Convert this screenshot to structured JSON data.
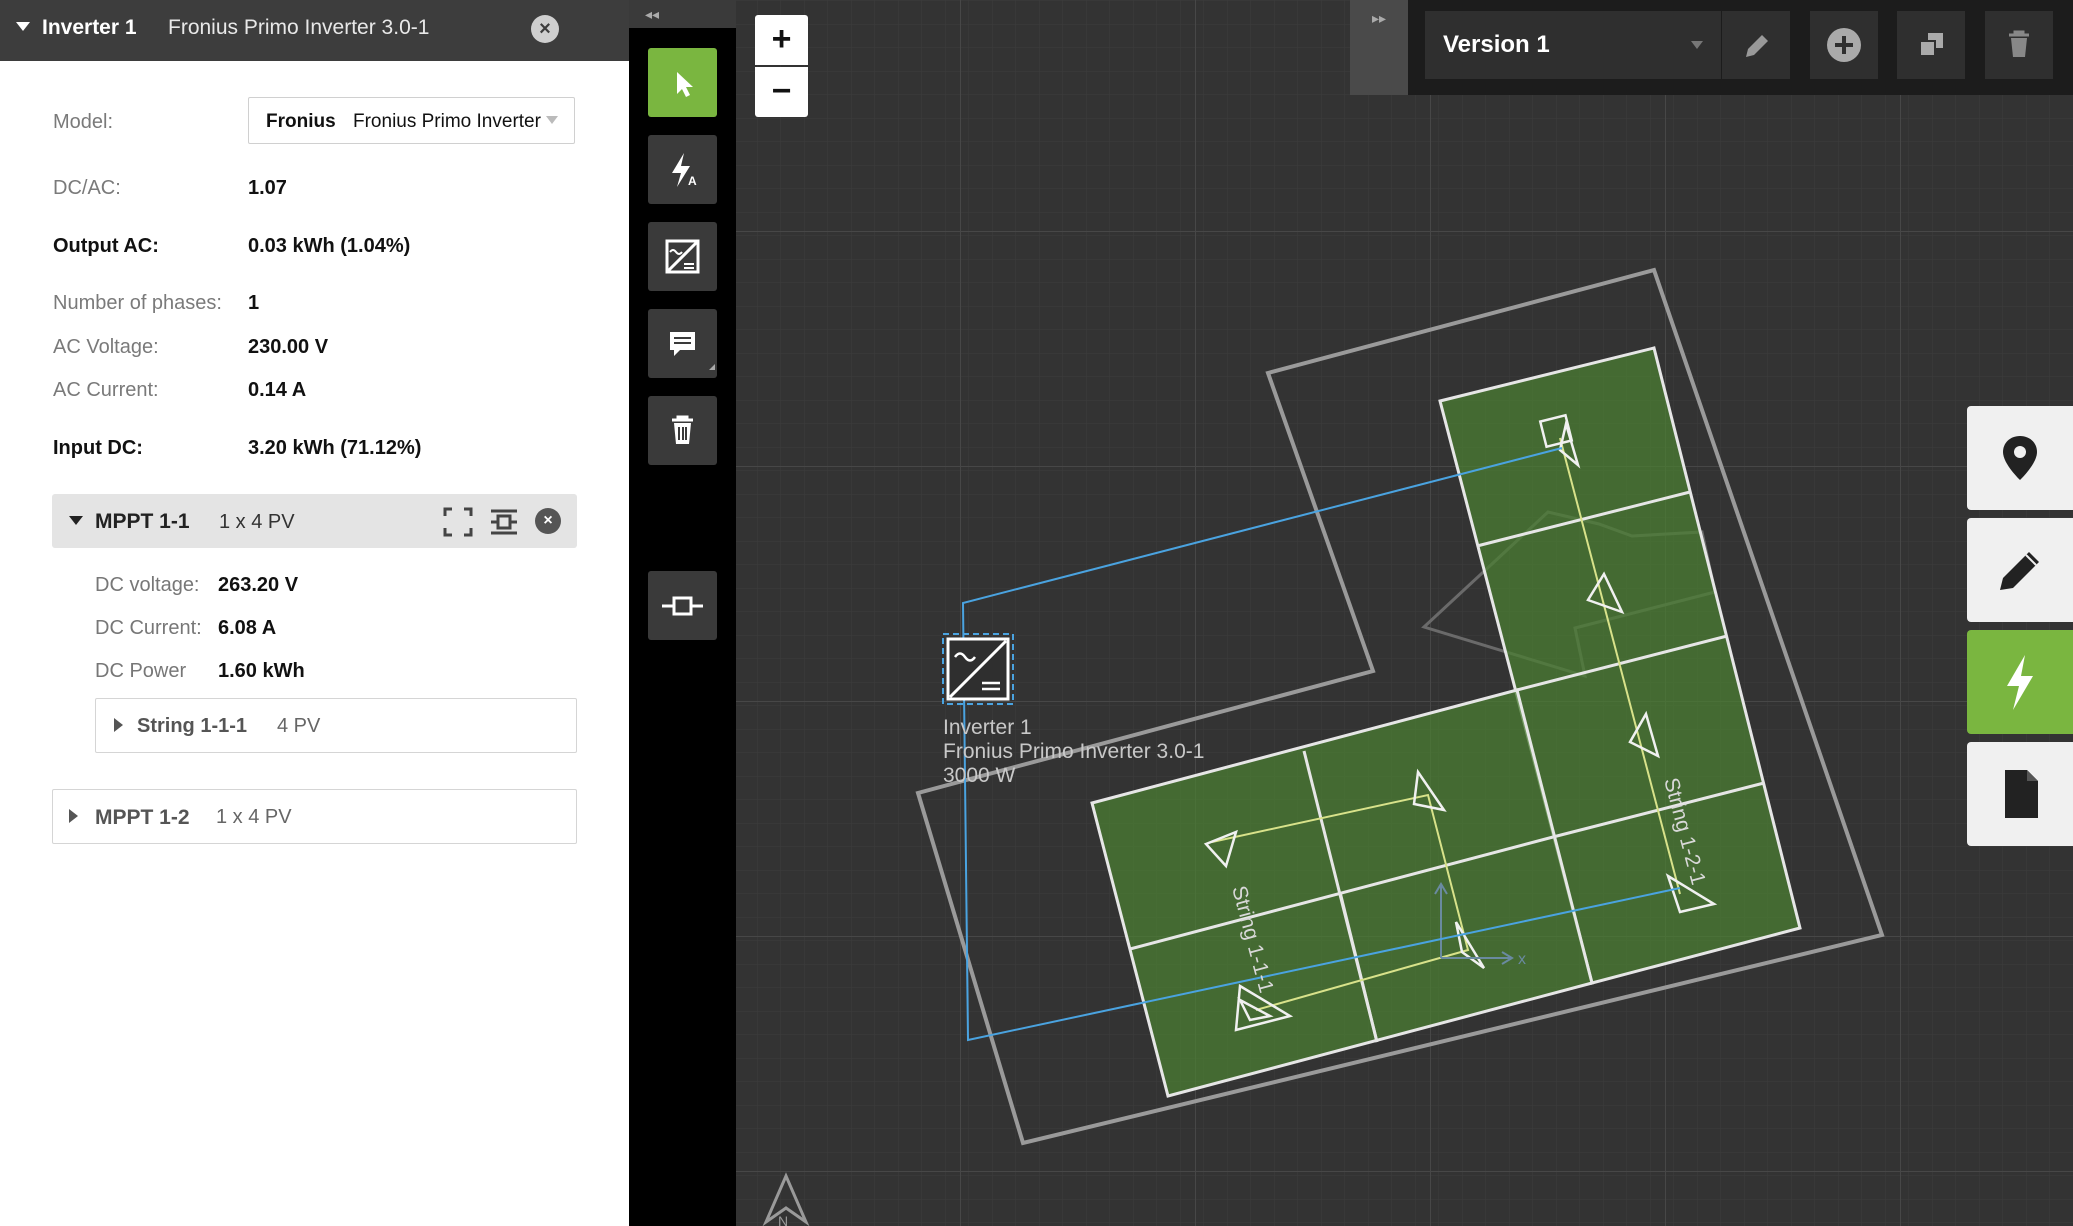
{
  "panel": {
    "header": {
      "name": "Inverter 1",
      "model": "Fronius Primo Inverter 3.0-1",
      "close_icon": "close-icon"
    },
    "model_label": "Model:",
    "model_brand": "Fronius",
    "model_name": "Fronius Primo Inverter",
    "dcac_label": "DC/AC:",
    "dcac_value": "1.07",
    "output_ac_label": "Output AC:",
    "output_ac_value": "0.03 kWh (1.04%)",
    "phases_label": "Number of phases:",
    "phases_value": "1",
    "ac_voltage_label": "AC Voltage:",
    "ac_voltage_value": "230.00 V",
    "ac_current_label": "AC Current:",
    "ac_current_value": "0.14 A",
    "input_dc_label": "Input DC:",
    "input_dc_value": "3.20 kWh (71.12%)",
    "mppt1": {
      "title": "MPPT 1-1",
      "config": "1 x 4 PV",
      "dc_voltage_label": "DC voltage:",
      "dc_voltage_value": "263.20 V",
      "dc_current_label": "DC Current:",
      "dc_current_value": "6.08 A",
      "dc_power_label": "DC Power",
      "dc_power_value": "1.60 kWh",
      "string": {
        "title": "String 1-1-1",
        "config": "4 PV"
      }
    },
    "mppt2": {
      "title": "MPPT 1-2",
      "config": "1 x 4 PV"
    }
  },
  "toolbar": {
    "collapse": "◂◂",
    "tools": [
      "select-tool-icon",
      "string-auto-icon",
      "inverter-tool-icon",
      "comment-tool-icon",
      "delete-tool-icon",
      "connector-tool-icon"
    ]
  },
  "zoom": {
    "in": "+",
    "out": "−"
  },
  "topbar": {
    "collapse": "▸▸",
    "version": "Version 1"
  },
  "canvas": {
    "inverter_label": {
      "name": "Inverter 1",
      "model": "Fronius Primo Inverter 3.0-1",
      "power": "3000 W"
    },
    "string_labels": [
      "String 1-1-1",
      "String 1-2-1"
    ],
    "axis_x": "x",
    "north": "N"
  },
  "colors": {
    "accent": "#7ab640",
    "wire": "#4aa3e0",
    "panel_fill": "#4b7d33"
  }
}
